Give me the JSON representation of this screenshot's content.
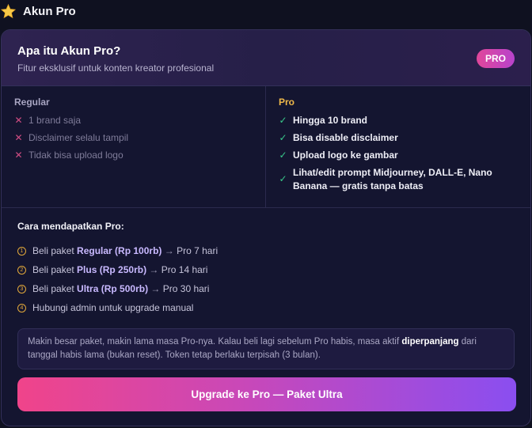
{
  "header": {
    "title": "Akun Pro",
    "icon": "star-icon"
  },
  "card": {
    "title": "Apa itu Akun Pro?",
    "subtitle": "Fitur eksklusif untuk konten kreator profesional",
    "badge": "PRO"
  },
  "regular": {
    "heading": "Regular",
    "items": [
      "1 brand saja",
      "Disclaimer selalu tampil",
      "Tidak bisa upload logo"
    ]
  },
  "pro": {
    "heading": "Pro",
    "items": [
      "Hingga 10 brand",
      "Bisa disable disclaimer",
      "Upload logo ke gambar",
      "Lihat/edit prompt Midjourney, DALL-E, Nano Banana — gratis tanpa batas"
    ]
  },
  "how": {
    "title": "Cara mendapatkan Pro:",
    "steps": [
      {
        "num": "1",
        "prefix": "Beli paket ",
        "package": "Regular (Rp 100rb)",
        "arrow": "→",
        "result": "Pro 7 hari"
      },
      {
        "num": "2",
        "prefix": "Beli paket ",
        "package": "Plus (Rp 250rb)",
        "arrow": "→",
        "result": "Pro 14 hari"
      },
      {
        "num": "3",
        "prefix": "Beli paket ",
        "package": "Ultra (Rp 500rb)",
        "arrow": "→",
        "result": "Pro 30 hari"
      },
      {
        "num": "4",
        "text": "Hubungi admin untuk upgrade manual"
      }
    ]
  },
  "note": {
    "before": "Makin besar paket, makin lama masa Pro-nya. Kalau beli lagi sebelum Pro habis, masa aktif ",
    "bold": "diperpanjang",
    "after": " dari tanggal habis lama (bukan reset). Token tetap berlaku terpisah (3 bulan)."
  },
  "cta": {
    "label": "Upgrade ke Pro — Paket Ultra"
  },
  "colors": {
    "accent_pink": "#f0448a",
    "accent_purple": "#8a4ef0",
    "check_green": "#38c98a",
    "cross_pink": "#d24d84",
    "pro_gold": "#f0b94a"
  }
}
